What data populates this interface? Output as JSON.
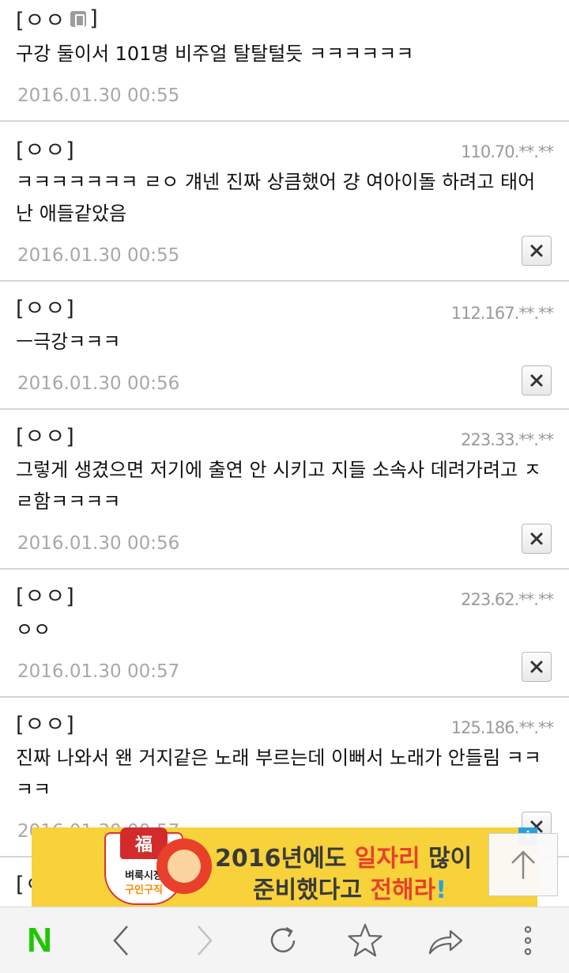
{
  "comments": [
    {
      "author": "[ㅇㅇ",
      "author_end": "]",
      "mobile": true,
      "ip": "",
      "text": "구강 둘이서 101명 비주얼 탈탈털듯 ㅋㅋㅋㅋㅋㅋ",
      "date": "2016.01.30 00:55",
      "deletable": false
    },
    {
      "author": "[ㅇㅇ]",
      "ip": "110.70.**.**",
      "text": "ㅋㅋㅋㅋㅋㅋㅋ ㄹㅇ 걔넨 진짜 상큼했어 걍 여아이돌 하려고 태어난 애들같았음",
      "date": "2016.01.30 00:55",
      "deletable": true
    },
    {
      "author": "[ㅇㅇ]",
      "ip": "112.167.**.**",
      "text": "ㅡ극강ㅋㅋㅋ",
      "date": "2016.01.30 00:56",
      "deletable": true
    },
    {
      "author": "[ㅇㅇ]",
      "ip": "223.33.**.**",
      "text": "그렇게 생겼으면 저기에 출연 안 시키고 지들 소속사 데려가려고 ㅈㄹ함ㅋㅋㅋㅋ",
      "date": "2016.01.30 00:56",
      "deletable": true
    },
    {
      "author": "[ㅇㅇ]",
      "ip": "223.62.**.**",
      "text": "ㅇㅇ",
      "date": "2016.01.30 00:57",
      "deletable": true
    },
    {
      "author": "[ㅇㅇ]",
      "ip": "125.186.**.**",
      "text": "진짜 나와서 왠 거지같은 노래 부르는데 이뻐서 노래가 안들림 ㅋㅋㅋㅋ",
      "date": "2016.01.30 00:57",
      "deletable": true
    }
  ],
  "partial_comment": {
    "author": "[ㅇ"
  },
  "ad": {
    "fu": "福",
    "brand_1": "벼룩시장",
    "brand_2": "구인구직",
    "line1_a": "2016년에도 ",
    "line1_b": "일자리",
    "line1_c": " 많이",
    "line2_a": "준비했다고 ",
    "line2_b": "전해라",
    "line2_c": "!",
    "info": "i"
  },
  "toolbar": {
    "naver_label": "N",
    "icons": [
      "naver-home-icon",
      "back-icon",
      "forward-icon",
      "refresh-icon",
      "bookmark-star-icon",
      "share-icon",
      "more-icon"
    ]
  },
  "colors": {
    "naver": "#1ec800",
    "accent_ad": "#f7d23a",
    "highlight": "#e8402a"
  }
}
